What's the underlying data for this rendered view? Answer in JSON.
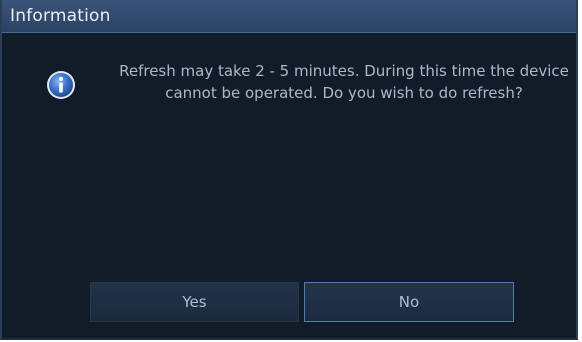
{
  "dialog": {
    "title": "Information",
    "icon": "info-icon",
    "message": "Refresh may take 2 - 5 minutes. During this time the device cannot be operated. Do you wish to do refresh?",
    "buttons": {
      "yes_label": "Yes",
      "no_label": "No"
    },
    "colors": {
      "background": "#121b28",
      "titlebar": "#34507a",
      "text": "#a9b9cc",
      "focus_border": "#4d7bb3"
    }
  }
}
